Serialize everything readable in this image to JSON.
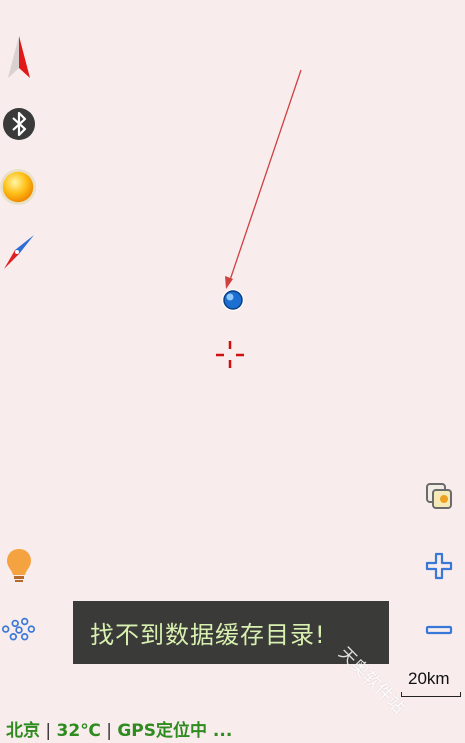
{
  "toast": {
    "message": "找不到数据缓存目录!"
  },
  "scale_bar": {
    "label": "20km"
  },
  "status_bar": {
    "city": "北京",
    "temperature": "32℃",
    "gps_status": "GPS定位中 ..."
  },
  "watermark": {
    "text": "天奥软件站"
  },
  "left_controls": [
    "north-arrow-icon",
    "bluetooth-icon",
    "sun-icon",
    "compass-icon",
    "lightbulb-icon",
    "track-points-icon"
  ],
  "right_controls": [
    "layers-icon",
    "zoom-in-icon",
    "zoom-out-icon"
  ],
  "colors": {
    "map_background": "#f8eced",
    "status_text": "#2e8b1e",
    "toast_background": "#3a3a38",
    "toast_text": "#d8f0b0",
    "zoom_controls": "#3a78d8",
    "crosshair": "#d01010",
    "direction_line": "#d04040"
  }
}
